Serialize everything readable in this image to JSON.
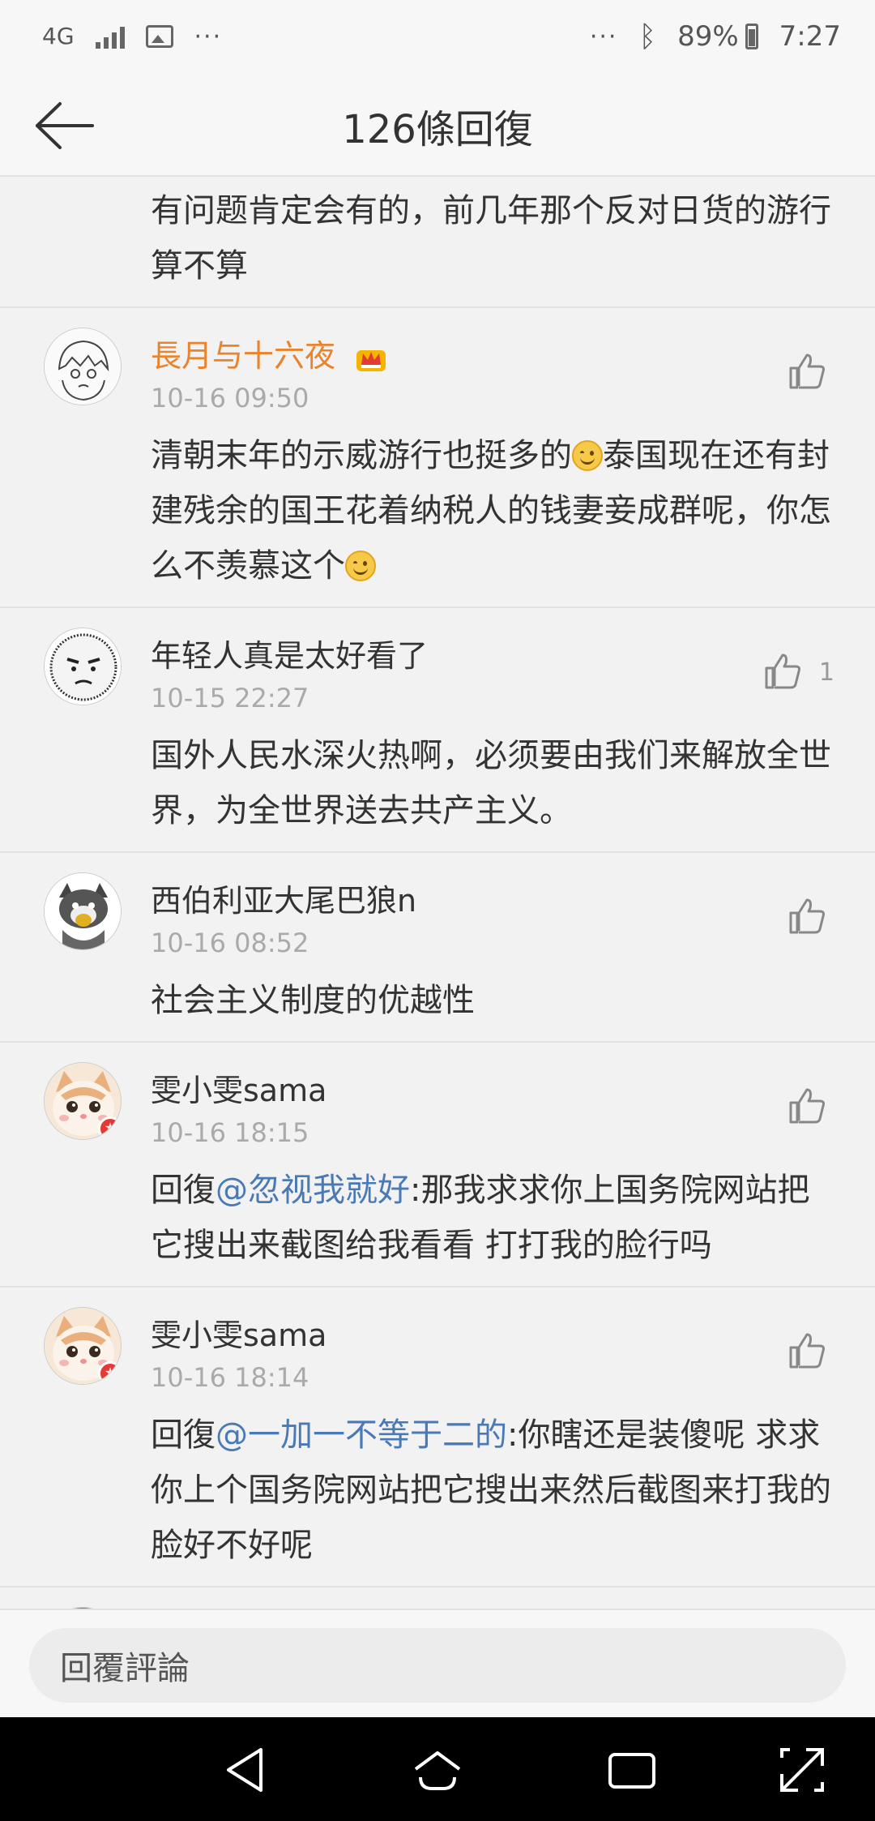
{
  "status": {
    "network": "4G",
    "battery": "89%",
    "time": "7:27",
    "icons": [
      "signal-icon",
      "image-icon",
      "more-icon",
      "bluetooth-icon",
      "battery-icon"
    ]
  },
  "header": {
    "title": "126條回復"
  },
  "comments": [
    {
      "type": "continuation",
      "text": "有问题肯定会有的，前几年那个反对日货的游行算不算"
    },
    {
      "username": "長月与十六夜",
      "vip": true,
      "date": "10-16 09:50",
      "likes": "",
      "text_a": "清朝末年的示威游行也挺多的",
      "text_b": "泰国现在还有封建残余的国王花着纳税人的钱妻妾成群呢，你怎么不羡慕这个"
    },
    {
      "username": "年轻人真是太好看了",
      "date": "10-15 22:27",
      "likes": "1",
      "text": "国外人民水深火热啊，必须要由我们来解放全世界，为全世界送去共产主义。"
    },
    {
      "username": "西伯利亚大尾巴狼n",
      "date": "10-16 08:52",
      "likes": "",
      "text": "社会主义制度的优越性"
    },
    {
      "username": "雯小雯sama",
      "date": "10-16 18:15",
      "likes": "",
      "reply_prefix": "回復",
      "mention": "@忽视我就好",
      "text": ":那我求求你上国务院网站把它搜出来截图给我看看 打打我的脸行吗"
    },
    {
      "username": "雯小雯sama",
      "date": "10-16 18:14",
      "likes": "",
      "reply_prefix": "回復",
      "mention": "@一加一不等于二的",
      "text": ":你瞎还是装傻呢 求求你上个国务院网站把它搜出来然后截图来打我的脸好不好呢"
    }
  ],
  "reply_box": {
    "placeholder": "回覆評論"
  },
  "colors": {
    "vip_name": "#e8842e",
    "mention": "#4a7ab5",
    "date": "#aaaaaa"
  }
}
